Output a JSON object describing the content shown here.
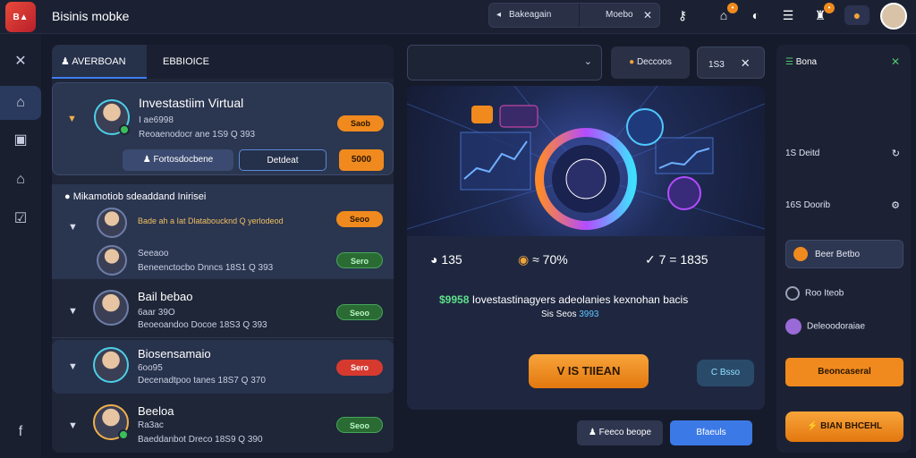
{
  "app": {
    "logo_text": "B▲",
    "title": "Bisinis mobke"
  },
  "topbar": {
    "search_left": "Bakeagain",
    "search_right": "Moebo",
    "close_icon": "✕",
    "icons": [
      "key-icon",
      "home-icon",
      "refresh-icon",
      "menu-icon",
      "bell-icon",
      "coin-icon"
    ],
    "badges": [
      "•",
      "•"
    ]
  },
  "rail": {
    "items": [
      "tools-icon",
      "home-icon",
      "square-icon",
      "home-icon",
      "check-icon",
      "facebook-icon"
    ]
  },
  "left_panel": {
    "tabs": [
      "AVERBOAN",
      "EBBIOICE"
    ],
    "featured": {
      "name": "Investastiim Virtual",
      "line1": "I ae6998",
      "line2": "Reoaenodocr ane 1S9 Q 393",
      "pill": "Saob",
      "btn_primary": "Fortosdocbene",
      "btn_input": "Detdeat",
      "btn_cta": "5000"
    },
    "section_header": "Mikamotiob sdeaddand Inirisei",
    "rows": [
      {
        "line_a": "Bade ah a Iat Dlataboucknd Q yerlodeod",
        "line_b": "",
        "pill": "Seoo",
        "pill_style": "orange"
      },
      {
        "line_a": "Seeaoo",
        "line_b": "Beneenctocbo Dnncs 18S1 Q 393",
        "pill": "Sero",
        "pill_style": "green"
      },
      {
        "name": "Bail bebao",
        "line_a": "6aar 39O",
        "line_b": "Beoeoandoo Docoe 18S3 Q 393",
        "pill": "Seoo",
        "pill_style": "green"
      },
      {
        "name": "Biosensamaio",
        "line_a": "6oo95",
        "line_b": "Decenadtpoo tanes 18S7 Q 370",
        "pill": "Sero",
        "pill_style": "red"
      },
      {
        "name": "Beeloa",
        "line_a": "Ra3ac",
        "line_b": "Baeddanbot Dreco 18S9 Q 390",
        "pill": "Seoo",
        "pill_style": "green"
      }
    ]
  },
  "center_panel": {
    "select_value": "",
    "chip1": "Deccoos",
    "chip2": "1S3",
    "stats": [
      "135",
      "≈ 70%",
      "7 = 1835"
    ],
    "description_lead": "$9958",
    "description": "Iovestastinagyers adeolanies kexnohan bacis",
    "description_sub_a": "Sis Seos",
    "description_sub_b": "3993",
    "cta_primary": "IS TIIEAN",
    "cta_primary_prefix": "V",
    "cta_secondary": "Bsso",
    "btn_bottom_left": "Feeco beope",
    "btn_bottom_right": "Bfaeuls"
  },
  "right_panel": {
    "header": "Bona",
    "items": [
      {
        "label": "1S Deitd"
      },
      {
        "label": "16S Doorib"
      },
      {
        "label": "Beer Betbo"
      },
      {
        "label": "Roo Iteob"
      },
      {
        "label": "Deleoodoraiae"
      }
    ],
    "btn_orange": "Beoncaseral",
    "btn_bottom": "BIAN BHCEHL"
  }
}
